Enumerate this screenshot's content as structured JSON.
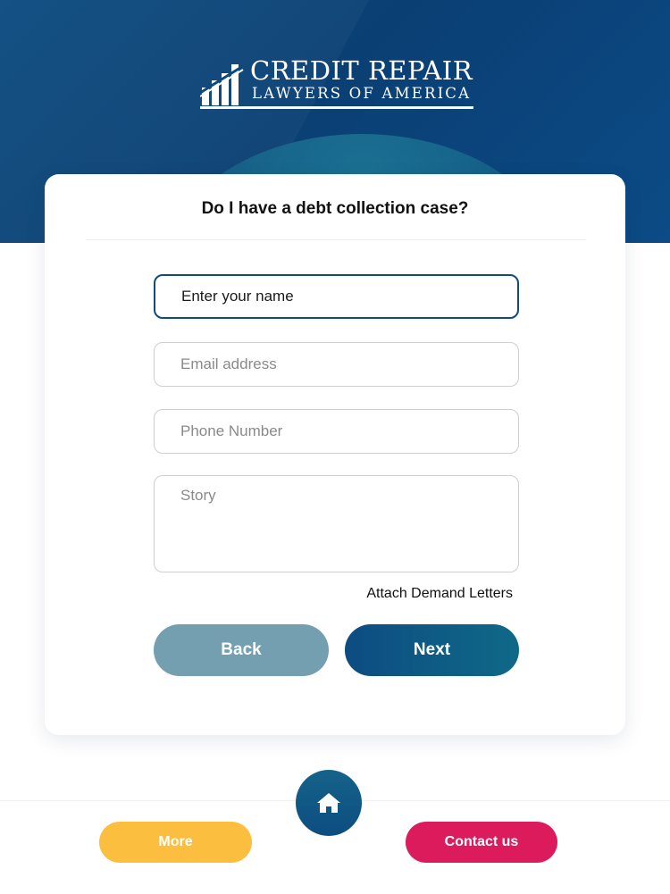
{
  "brand": {
    "line1": "CREDIT REPAIR",
    "line2": "LAWYERS OF AMERICA",
    "icon": "building-pillars-logo-icon"
  },
  "form": {
    "title": "Do I have a debt collection case?",
    "name_placeholder": "Enter your name",
    "email_placeholder": "Email address",
    "phone_placeholder": "Phone Number",
    "story_placeholder": "Story",
    "attach_label": "Attach Demand Letters",
    "back_label": "Back",
    "next_label": "Next"
  },
  "bottom_nav": {
    "more_label": "More",
    "contact_label": "Contact us",
    "home_icon": "home-icon"
  },
  "colors": {
    "header_blue": "#0b4a7f",
    "back_button": "#739fb1",
    "next_button": "#0d4c82",
    "more_button": "#fcbe3f",
    "contact_button": "#dc1b5c",
    "home_button": "#0c4d80"
  }
}
